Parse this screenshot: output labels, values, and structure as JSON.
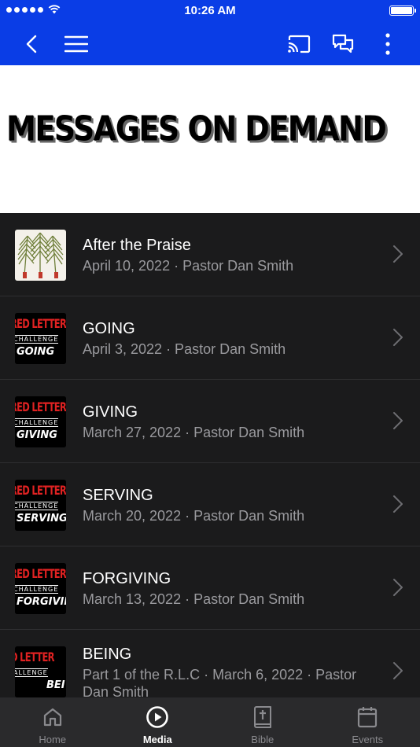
{
  "status_bar": {
    "time": "10:26 AM"
  },
  "nav": {
    "back_icon": "chevron-left-icon",
    "menu_icon": "hamburger-menu-icon",
    "cast_icon": "cast-icon",
    "chat_icon": "chat-bubbles-icon",
    "more_icon": "more-vertical-icon"
  },
  "banner": {
    "title": "MESSAGES ON DEMAND"
  },
  "messages": [
    {
      "title": "After the Praise",
      "subtitle": "April 10, 2022 · Pastor Dan Smith",
      "thumb": "palm-branches"
    },
    {
      "title": "GOING",
      "subtitle": "April 3, 2022 · Pastor Dan Smith",
      "thumb": "red-letter-challenge",
      "thumb_red": "RED LETTER",
      "thumb_challenge": "CHALLENGE",
      "thumb_word": "GOING"
    },
    {
      "title": "GIVING",
      "subtitle": "March 27, 2022 · Pastor Dan Smith",
      "thumb": "red-letter-challenge",
      "thumb_red": "RED LETTER",
      "thumb_challenge": "CHALLENGE",
      "thumb_word": "GIVING"
    },
    {
      "title": "SERVING",
      "subtitle": "March 20, 2022 · Pastor Dan Smith",
      "thumb": "red-letter-challenge",
      "thumb_red": "RED LETTER",
      "thumb_challenge": "CHALLENGE",
      "thumb_word": "SERVING"
    },
    {
      "title": "FORGIVING",
      "subtitle": "March 13, 2022 · Pastor Dan Smith",
      "thumb": "red-letter-challenge",
      "thumb_red": "RED LETTER",
      "thumb_challenge": "CHALLENGE",
      "thumb_word": "FORGIVING"
    },
    {
      "title": "BEING",
      "subtitle": "Part 1 of the R.L.C · March 6, 2022 · Pastor Dan Smith",
      "thumb": "red-letter-challenge",
      "thumb_red": "D LETTER",
      "thumb_challenge": "ALLENGE",
      "thumb_word": "BEI"
    }
  ],
  "tabs": [
    {
      "label": "Home",
      "icon": "home-icon",
      "active": false
    },
    {
      "label": "Media",
      "icon": "play-circle-icon",
      "active": true
    },
    {
      "label": "Bible",
      "icon": "bible-icon",
      "active": false
    },
    {
      "label": "Events",
      "icon": "calendar-icon",
      "active": false
    }
  ],
  "colors": {
    "brand": "#0a3de6",
    "list_bg": "#1b1b1c",
    "tab_bg": "#2a2a2c",
    "accent_red": "#e02222"
  }
}
